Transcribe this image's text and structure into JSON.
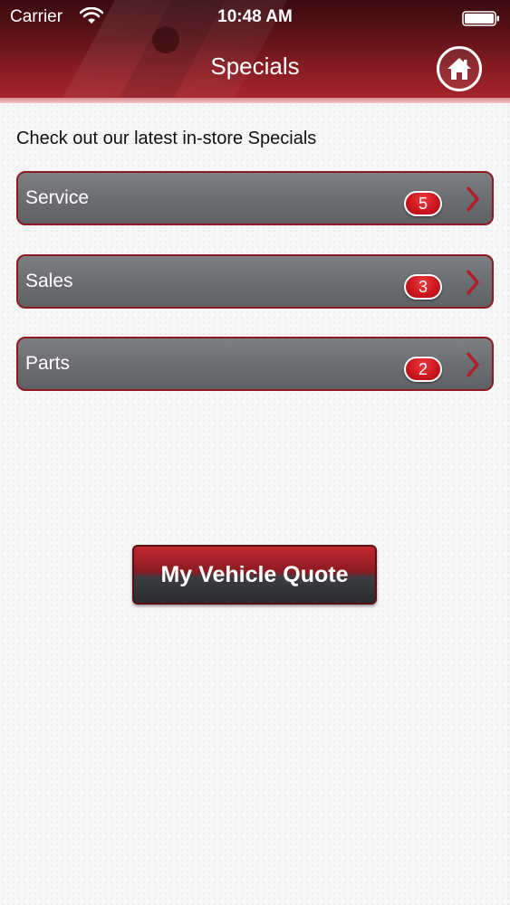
{
  "status_bar": {
    "carrier": "Carrier",
    "time": "10:48 AM",
    "wifi_icon": "wifi-icon",
    "battery_icon": "battery-icon"
  },
  "header": {
    "title": "Specials",
    "home_icon": "home-icon"
  },
  "content": {
    "intro": "Check out our latest in-store Specials",
    "items": [
      {
        "label": "Service",
        "count": "5"
      },
      {
        "label": "Sales",
        "count": "3"
      },
      {
        "label": "Parts",
        "count": "2"
      }
    ],
    "quote_button": "My Vehicle Quote"
  },
  "colors": {
    "header_dark": "#3a0b0f",
    "header_red": "#a8252c",
    "row_gray": "#6c6e71",
    "row_border": "#8e1b22",
    "badge_red": "#c9141c"
  }
}
